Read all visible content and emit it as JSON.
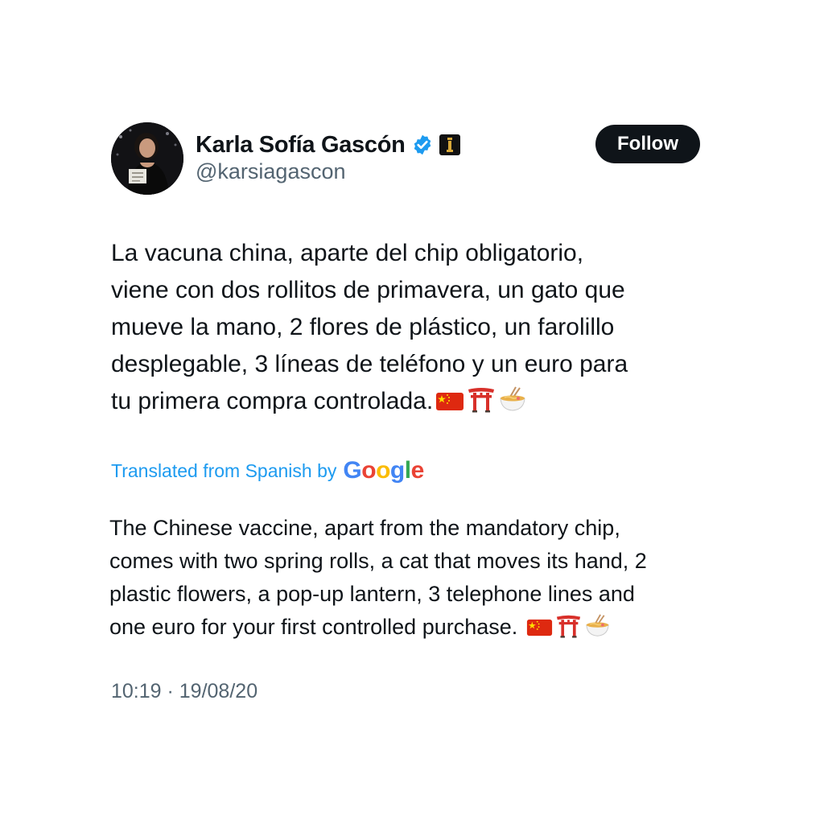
{
  "author": {
    "name": "Karla Sofía Gascón",
    "handle": "@karsiagascon",
    "verified_color": "#1d9bf0"
  },
  "follow_button": {
    "label": "Follow"
  },
  "tweet": {
    "lines": [
      "La vacuna china, aparte del chip obligatorio,",
      "viene con dos rollitos de primavera, un gato que",
      "mueve la mano, 2 flores de plástico, un farolillo",
      "desplegable, 3 líneas de teléfono y un euro para",
      "tu primera compra controlada."
    ],
    "emojis": [
      "china-flag-icon",
      "torii-gate-icon",
      "noodle-bowl-icon"
    ]
  },
  "translation": {
    "label": "Translated from Spanish by",
    "provider": "Google",
    "lines": [
      "The Chinese vaccine, apart from the mandatory chip,",
      "comes with two spring rolls, a cat that moves its hand, 2",
      "plastic flowers, a pop-up lantern, 3 telephone lines and",
      "one euro for your first controlled purchase. "
    ]
  },
  "timestamp": "10:19 · 19/08/20",
  "colors": {
    "text": "#0f1419",
    "secondary": "#536471",
    "link": "#1d9bf0",
    "button_bg": "#0f1419"
  }
}
